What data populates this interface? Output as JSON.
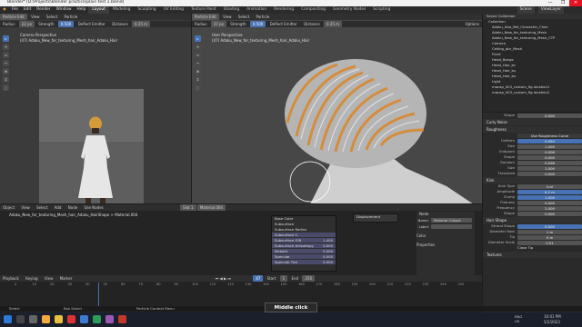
{
  "window": {
    "title": "Blender* [D:\\Projects\\Blender practice\\plain test 1.blend]",
    "controls": [
      "—",
      "❐",
      "✕"
    ]
  },
  "menu": [
    "File",
    "Edit",
    "Render",
    "Window",
    "Help"
  ],
  "workspaces": [
    "Layout",
    "Modeling",
    "Sculpting",
    "UV Editing",
    "Texture Paint",
    "Shading",
    "Animation",
    "Rendering",
    "Compositing",
    "Geometry Nodes",
    "Scripting"
  ],
  "scene": {
    "scene_name": "Scene",
    "view_layer": "ViewLayer"
  },
  "left_vp": {
    "mode": "Particle Edit",
    "menus": [
      "View",
      "Select",
      "Particle"
    ],
    "tools": {
      "radius_label": "Radius",
      "radius_val": "22 px",
      "strength_label": "Strength",
      "strength_val": "0.500",
      "deflect": "Deflect Emitter",
      "distance_label": "Distance",
      "distance_val": "0.25 m"
    },
    "view_name": "Camera Perspective",
    "object_line": "(47) Adaku_New_for_texturing_Mesh_hair_Adaku_Hair"
  },
  "right_vp": {
    "mode": "Particle Edit",
    "menus": [
      "View",
      "Select",
      "Particle"
    ],
    "tools": {
      "radius_label": "Radius",
      "radius_val": "37 px",
      "strength_label": "Strength",
      "strength_val": "0.500",
      "deflect": "Deflect Emitter",
      "distance_label": "Distance",
      "distance_val": "0.25 m",
      "options": "Options"
    },
    "view_name": "User Perspective",
    "object_line": "(47) Adaku_New_for_texturing_Mesh_hair_Adaku_Hair"
  },
  "outliner": {
    "header": "Scene Collection",
    "rows": [
      {
        "label": "Collection",
        "sel": false
      },
      {
        "label": "Adaku_Uba_Bet_Character_Chan",
        "sel": false
      },
      {
        "label": "Adaku_New_for_texturing_Mesh",
        "sel": false
      },
      {
        "label": "Adaku_New_for_texturing_Mesh_CTP",
        "sel": false
      },
      {
        "label": "Camera",
        "sel": false
      },
      {
        "label": "Ceiling_pbr_Mesh",
        "sel": false
      },
      {
        "label": "Front",
        "sel": false
      },
      {
        "label": "Head_Bangs",
        "sel": false
      },
      {
        "label": "Head_Hair_bc",
        "sel": false
      },
      {
        "label": "Head_Hair_bu",
        "sel": false
      },
      {
        "label": "Head_Hair_bu",
        "sel": false
      },
      {
        "label": "Light",
        "sel": false
      },
      {
        "label": "macap_003_custom_fig.location1",
        "sel": false
      },
      {
        "label": "macap_003_custom_fig.location2",
        "sel": false
      }
    ]
  },
  "properties": {
    "shape": {
      "label": "Shape",
      "val": "0.000"
    },
    "curly": "Curly Noise",
    "roughness_header": "Roughness",
    "use_curve": "Use Roughness Curve",
    "rough_rows": [
      {
        "label": "Uniform",
        "val": "0.050"
      },
      {
        "label": "Size",
        "val": "1.000"
      },
      {
        "label": "Endpoint",
        "val": "0.006"
      },
      {
        "label": "Shape",
        "val": "0.000"
      },
      {
        "label": "Random",
        "val": "0.096"
      },
      {
        "label": "Size",
        "val": "1.000"
      },
      {
        "label": "Threshold",
        "val": "0.000"
      }
    ],
    "kink_header": "Kink",
    "kink_type": {
      "label": "Kink Type",
      "val": "Curl"
    },
    "kink_rows": [
      {
        "label": "Amplitude",
        "val": "0.2 m"
      },
      {
        "label": "Clump",
        "val": "1.000"
      },
      {
        "label": "Flatness",
        "val": "0.000"
      },
      {
        "label": "Frequency",
        "val": "2.000"
      },
      {
        "label": "Shape",
        "val": "0.000"
      }
    ],
    "hair_shape_header": "Hair Shape",
    "hair_rows": [
      {
        "label": "Strand Shape",
        "val": "0.000"
      },
      {
        "label": "Diameter Root",
        "val": "1 m"
      },
      {
        "label": "Tip",
        "val": "0 m"
      },
      {
        "label": "Diameter Scale",
        "val": "0.01"
      }
    ],
    "close_tip": "Close Tip",
    "textures": "Textures"
  },
  "node_editor": {
    "header": [
      "Object",
      "View",
      "Select",
      "Add",
      "Node",
      "Use Nodes"
    ],
    "slot": "Slot 1",
    "material": "Material.004",
    "breadcrumb": [
      "Adaku_New_for_texturing_Mesh_hair_Adaku_HairShape",
      "Material.004"
    ],
    "principled": {
      "rows": [
        "Base Color",
        "Subsurface",
        "Subsurface Radius",
        "Subsurface C.",
        "Subsurface IOR",
        "Subsurface Anisotropy",
        "Metallic",
        "Specular",
        "Specular Tint"
      ],
      "vals": [
        "",
        "",
        "",
        "",
        "1.400",
        "0.000",
        "0.000",
        "0.500",
        "0.000"
      ]
    },
    "displacement": "Displacement",
    "node_panel": {
      "title": "Node",
      "name_label": "Name:",
      "name_val": "Material Output",
      "label_label": "Label:",
      "color": "Color",
      "properties": "Properties"
    }
  },
  "timeline": {
    "menus": [
      "Playback",
      "Keying",
      "View",
      "Marker"
    ],
    "frame": "47",
    "start_label": "Start",
    "start_val": "1",
    "end_label": "End",
    "end_val": "250",
    "ticks": [
      "0",
      "10",
      "20",
      "30",
      "40",
      "50",
      "60",
      "70",
      "80",
      "90",
      "100",
      "110",
      "120",
      "130",
      "140",
      "150",
      "160",
      "170",
      "180",
      "190",
      "200",
      "210",
      "220",
      "230",
      "240",
      "250"
    ]
  },
  "status": {
    "left": "Select",
    "mid": "Box Select",
    "right": "Particle Context Menu",
    "tooltip": "Middle click"
  },
  "taskbar": {
    "time": "10:01 PM",
    "date": "5/2/2023",
    "lang": "ENG\nUS"
  },
  "colors": {
    "accent": "#4772b3",
    "hair_orange": "#d8892f",
    "bg": "#3d3d3d"
  }
}
